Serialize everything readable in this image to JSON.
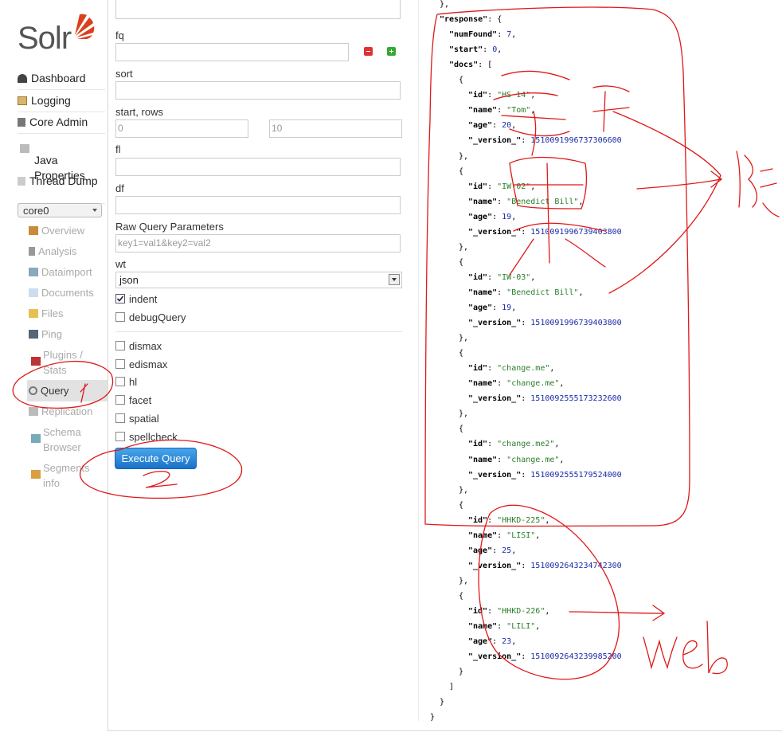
{
  "logo": {
    "text": "Solr"
  },
  "nav": [
    {
      "label": "Dashboard",
      "icon": "dashboard-icon"
    },
    {
      "label": "Logging",
      "icon": "logging-icon"
    },
    {
      "label": "Core Admin",
      "icon": "core-admin-icon"
    },
    {
      "label": "Java\nProperties",
      "icon": "java-icon"
    },
    {
      "label": "Thread Dump",
      "icon": "thread-dump-icon"
    }
  ],
  "core_selector": {
    "value": "core0"
  },
  "core_nav": [
    {
      "label": "Overview",
      "icon": "home-icon"
    },
    {
      "label": "Analysis",
      "icon": "filter-icon"
    },
    {
      "label": "Dataimport",
      "icon": "dataimport-icon"
    },
    {
      "label": "Documents",
      "icon": "documents-icon"
    },
    {
      "label": "Files",
      "icon": "folder-icon"
    },
    {
      "label": "Ping",
      "icon": "ping-icon"
    },
    {
      "label": "Plugins /\nStats",
      "icon": "plugins-icon"
    },
    {
      "label": "Query",
      "icon": "search-icon"
    },
    {
      "label": "Replication",
      "icon": "replication-icon"
    },
    {
      "label": "Schema\nBrowser",
      "icon": "schema-icon"
    },
    {
      "label": "Segments\ninfo",
      "icon": "segments-icon"
    }
  ],
  "form": {
    "fq_label": "fq",
    "sort_label": "sort",
    "start_rows_label": "start, rows",
    "start_value": "0",
    "rows_value": "10",
    "fl_label": "fl",
    "df_label": "df",
    "raw_label": "Raw Query Parameters",
    "raw_placeholder": "key1=val1&key2=val2",
    "wt_label": "wt",
    "wt_value": "json",
    "indent_label": "indent",
    "indent_checked": true,
    "debug_label": "debugQuery",
    "options": [
      "dismax",
      "edismax",
      "hl",
      "facet",
      "spatial",
      "spellcheck"
    ],
    "execute_label": "Execute Query"
  },
  "json_lines": [
    {
      "i": 1,
      "t": [
        [
          "p",
          "},"
        ]
      ]
    },
    {
      "i": 1,
      "t": [
        [
          "k",
          "\"response\""
        ],
        [
          "p",
          ": {"
        ]
      ]
    },
    {
      "i": 2,
      "t": [
        [
          "k",
          "\"numFound\""
        ],
        [
          "p",
          ": "
        ],
        [
          "n",
          "7"
        ],
        [
          "p",
          ","
        ]
      ]
    },
    {
      "i": 2,
      "t": [
        [
          "k",
          "\"start\""
        ],
        [
          "p",
          ": "
        ],
        [
          "n",
          "0"
        ],
        [
          "p",
          ","
        ]
      ]
    },
    {
      "i": 2,
      "t": [
        [
          "k",
          "\"docs\""
        ],
        [
          "p",
          ": ["
        ]
      ]
    },
    {
      "i": 3,
      "t": [
        [
          "p",
          "{"
        ]
      ]
    },
    {
      "i": 4,
      "t": [
        [
          "k",
          "\"id\""
        ],
        [
          "p",
          ": "
        ],
        [
          "s",
          "\"HS-14\""
        ],
        [
          "p",
          ","
        ]
      ]
    },
    {
      "i": 4,
      "t": [
        [
          "k",
          "\"name\""
        ],
        [
          "p",
          ": "
        ],
        [
          "s",
          "\"Tom\""
        ],
        [
          "p",
          ","
        ]
      ]
    },
    {
      "i": 4,
      "t": [
        [
          "k",
          "\"age\""
        ],
        [
          "p",
          ": "
        ],
        [
          "n",
          "20"
        ],
        [
          "p",
          ","
        ]
      ]
    },
    {
      "i": 4,
      "t": [
        [
          "k",
          "\"_version_\""
        ],
        [
          "p",
          ": "
        ],
        [
          "n",
          "1510091996737306600"
        ]
      ]
    },
    {
      "i": 3,
      "t": [
        [
          "p",
          "},"
        ]
      ]
    },
    {
      "i": 3,
      "t": [
        [
          "p",
          "{"
        ]
      ]
    },
    {
      "i": 4,
      "t": [
        [
          "k",
          "\"id\""
        ],
        [
          "p",
          ": "
        ],
        [
          "s",
          "\"IW-02\""
        ],
        [
          "p",
          ","
        ]
      ]
    },
    {
      "i": 4,
      "t": [
        [
          "k",
          "\"name\""
        ],
        [
          "p",
          ": "
        ],
        [
          "s",
          "\"Benedict Bill\""
        ],
        [
          "p",
          ","
        ]
      ]
    },
    {
      "i": 4,
      "t": [
        [
          "k",
          "\"age\""
        ],
        [
          "p",
          ": "
        ],
        [
          "n",
          "19"
        ],
        [
          "p",
          ","
        ]
      ]
    },
    {
      "i": 4,
      "t": [
        [
          "k",
          "\"_version_\""
        ],
        [
          "p",
          ": "
        ],
        [
          "n",
          "1510091996739403800"
        ]
      ]
    },
    {
      "i": 3,
      "t": [
        [
          "p",
          "},"
        ]
      ]
    },
    {
      "i": 3,
      "t": [
        [
          "p",
          "{"
        ]
      ]
    },
    {
      "i": 4,
      "t": [
        [
          "k",
          "\"id\""
        ],
        [
          "p",
          ": "
        ],
        [
          "s",
          "\"IW-03\""
        ],
        [
          "p",
          ","
        ]
      ]
    },
    {
      "i": 4,
      "t": [
        [
          "k",
          "\"name\""
        ],
        [
          "p",
          ": "
        ],
        [
          "s",
          "\"Benedict Bill\""
        ],
        [
          "p",
          ","
        ]
      ]
    },
    {
      "i": 4,
      "t": [
        [
          "k",
          "\"age\""
        ],
        [
          "p",
          ": "
        ],
        [
          "n",
          "19"
        ],
        [
          "p",
          ","
        ]
      ]
    },
    {
      "i": 4,
      "t": [
        [
          "k",
          "\"_version_\""
        ],
        [
          "p",
          ": "
        ],
        [
          "n",
          "1510091996739403800"
        ]
      ]
    },
    {
      "i": 3,
      "t": [
        [
          "p",
          "},"
        ]
      ]
    },
    {
      "i": 3,
      "t": [
        [
          "p",
          "{"
        ]
      ]
    },
    {
      "i": 4,
      "t": [
        [
          "k",
          "\"id\""
        ],
        [
          "p",
          ": "
        ],
        [
          "s",
          "\"change.me\""
        ],
        [
          "p",
          ","
        ]
      ]
    },
    {
      "i": 4,
      "t": [
        [
          "k",
          "\"name\""
        ],
        [
          "p",
          ": "
        ],
        [
          "s",
          "\"change.me\""
        ],
        [
          "p",
          ","
        ]
      ]
    },
    {
      "i": 4,
      "t": [
        [
          "k",
          "\"_version_\""
        ],
        [
          "p",
          ": "
        ],
        [
          "n",
          "1510092555173232600"
        ]
      ]
    },
    {
      "i": 3,
      "t": [
        [
          "p",
          "},"
        ]
      ]
    },
    {
      "i": 3,
      "t": [
        [
          "p",
          "{"
        ]
      ]
    },
    {
      "i": 4,
      "t": [
        [
          "k",
          "\"id\""
        ],
        [
          "p",
          ": "
        ],
        [
          "s",
          "\"change.me2\""
        ],
        [
          "p",
          ","
        ]
      ]
    },
    {
      "i": 4,
      "t": [
        [
          "k",
          "\"name\""
        ],
        [
          "p",
          ": "
        ],
        [
          "s",
          "\"change.me\""
        ],
        [
          "p",
          ","
        ]
      ]
    },
    {
      "i": 4,
      "t": [
        [
          "k",
          "\"_version_\""
        ],
        [
          "p",
          ": "
        ],
        [
          "n",
          "1510092555179524000"
        ]
      ]
    },
    {
      "i": 3,
      "t": [
        [
          "p",
          "},"
        ]
      ]
    },
    {
      "i": 3,
      "t": [
        [
          "p",
          "{"
        ]
      ]
    },
    {
      "i": 4,
      "t": [
        [
          "k",
          "\"id\""
        ],
        [
          "p",
          ": "
        ],
        [
          "s",
          "\"HHKD-225\""
        ],
        [
          "p",
          ","
        ]
      ]
    },
    {
      "i": 4,
      "t": [
        [
          "k",
          "\"name\""
        ],
        [
          "p",
          ": "
        ],
        [
          "s",
          "\"LISI\""
        ],
        [
          "p",
          ","
        ]
      ]
    },
    {
      "i": 4,
      "t": [
        [
          "k",
          "\"age\""
        ],
        [
          "p",
          ": "
        ],
        [
          "n",
          "25"
        ],
        [
          "p",
          ","
        ]
      ]
    },
    {
      "i": 4,
      "t": [
        [
          "k",
          "\"_version_\""
        ],
        [
          "p",
          ": "
        ],
        [
          "n",
          "1510092643234742300"
        ]
      ]
    },
    {
      "i": 3,
      "t": [
        [
          "p",
          "},"
        ]
      ]
    },
    {
      "i": 3,
      "t": [
        [
          "p",
          "{"
        ]
      ]
    },
    {
      "i": 4,
      "t": [
        [
          "k",
          "\"id\""
        ],
        [
          "p",
          ": "
        ],
        [
          "s",
          "\"HHKD-226\""
        ],
        [
          "p",
          ","
        ]
      ]
    },
    {
      "i": 4,
      "t": [
        [
          "k",
          "\"name\""
        ],
        [
          "p",
          ": "
        ],
        [
          "s",
          "\"LILI\""
        ],
        [
          "p",
          ","
        ]
      ]
    },
    {
      "i": 4,
      "t": [
        [
          "k",
          "\"age\""
        ],
        [
          "p",
          ": "
        ],
        [
          "n",
          "23"
        ],
        [
          "p",
          ","
        ]
      ]
    },
    {
      "i": 4,
      "t": [
        [
          "k",
          "\"_version_\""
        ],
        [
          "p",
          ": "
        ],
        [
          "n",
          "1510092643239985200"
        ]
      ]
    },
    {
      "i": 3,
      "t": [
        [
          "p",
          "}"
        ]
      ]
    },
    {
      "i": 2,
      "t": [
        [
          "p",
          "]"
        ]
      ]
    },
    {
      "i": 1,
      "t": [
        [
          "p",
          "}"
        ]
      ]
    },
    {
      "i": 0,
      "t": [
        [
          "p",
          "}"
        ]
      ]
    }
  ],
  "annotations": {
    "numbers": [
      "1",
      "2"
    ],
    "handwritten_text": "web",
    "ink_color": "#e01818"
  }
}
